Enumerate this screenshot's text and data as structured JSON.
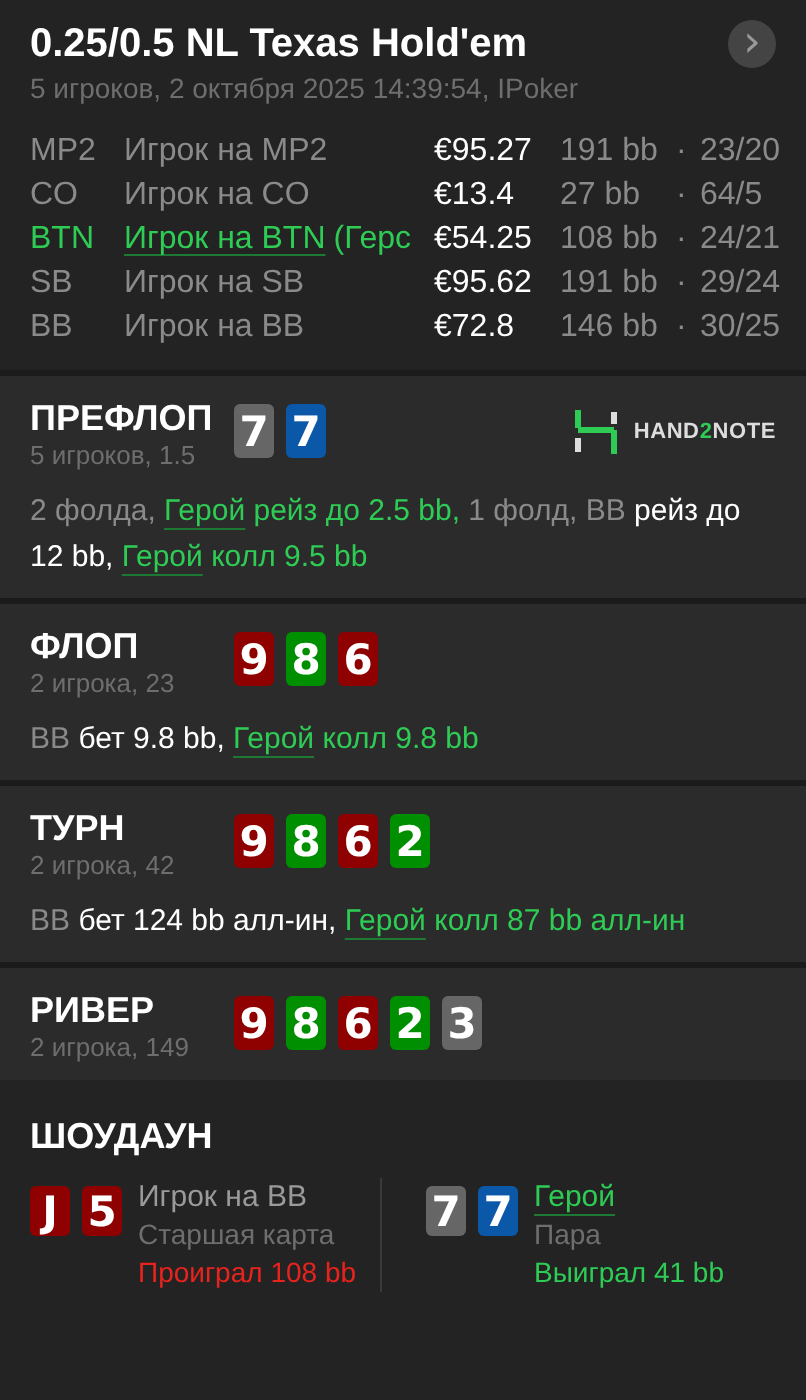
{
  "header": {
    "title": "0.25/0.5 NL Texas Hold'em",
    "subtitle": "5 игроков, 2 октября 2025 14:39:54, IPoker",
    "next_button": "›"
  },
  "players": [
    {
      "position": "MP2",
      "name": "Игрок на MP2",
      "hero": false,
      "stack": "€95.27",
      "bb": "191 bb",
      "separator": "·",
      "stats": "23/20"
    },
    {
      "position": "CO",
      "name": "Игрок на CO",
      "hero": false,
      "stack": "€13.4",
      "bb": "27 bb",
      "separator": "·",
      "stats": "64/5"
    },
    {
      "position": "BTN",
      "name": "Игрок на BTN",
      "note": "(Герс",
      "hero": true,
      "stack": "€54.25",
      "bb": "108 bb",
      "separator": "·",
      "stats": "24/21"
    },
    {
      "position": "SB",
      "name": "Игрок на SB",
      "hero": false,
      "stack": "€95.62",
      "bb": "191 bb",
      "separator": "·",
      "stats": "29/24"
    },
    {
      "position": "BB",
      "name": "Игрок на BB",
      "hero": false,
      "stack": "€72.8",
      "bb": "146 bb",
      "separator": "·",
      "stats": "30/25"
    }
  ],
  "streets": [
    {
      "title": "ПРЕФЛОП",
      "subtitle": "5 игроков, 1.5",
      "logo": {
        "before": "HAND",
        "accent": "2",
        "after": "NOTE"
      },
      "cards": [
        {
          "rank": "7",
          "color": "#666666"
        },
        {
          "rank": "7",
          "color": "#0b57a8"
        }
      ],
      "actions": [
        {
          "kind": "muted",
          "text": "2 фолда, "
        },
        {
          "kind": "hero-link",
          "text": "Герой"
        },
        {
          "kind": "hero",
          "text": " рейз до 2.5 bb, "
        },
        {
          "kind": "muted",
          "text": "1 фолд, BB "
        },
        {
          "kind": "bold",
          "text": "рейз до 12 bb, "
        },
        {
          "kind": "hero-link",
          "text": "Герой"
        },
        {
          "kind": "hero",
          "text": " колл 9.5 bb"
        }
      ]
    },
    {
      "title": "ФЛОП",
      "subtitle": "2 игрока, 23",
      "cards": [
        {
          "rank": "9",
          "color": "#8f0000"
        },
        {
          "rank": "8",
          "color": "#008f00"
        },
        {
          "rank": "6",
          "color": "#8f0000"
        }
      ],
      "actions": [
        {
          "kind": "muted",
          "text": "BB "
        },
        {
          "kind": "bold",
          "text": "бет 9.8 bb, "
        },
        {
          "kind": "hero-link",
          "text": "Герой"
        },
        {
          "kind": "hero",
          "text": " колл 9.8 bb"
        }
      ]
    },
    {
      "title": "ТУРН",
      "subtitle": "2 игрока, 42",
      "cards": [
        {
          "rank": "9",
          "color": "#8f0000"
        },
        {
          "rank": "8",
          "color": "#008f00"
        },
        {
          "rank": "6",
          "color": "#8f0000"
        },
        {
          "rank": "2",
          "color": "#008f00"
        }
      ],
      "actions": [
        {
          "kind": "muted",
          "text": "BB "
        },
        {
          "kind": "bold",
          "text": "бет 124 bb алл-ин, "
        },
        {
          "kind": "hero-link",
          "text": "Герой"
        },
        {
          "kind": "hero",
          "text": " колл 87 bb алл-ин"
        }
      ]
    },
    {
      "title": "РИВЕР",
      "subtitle": "2 игрока, 149",
      "cards": [
        {
          "rank": "9",
          "color": "#8f0000"
        },
        {
          "rank": "8",
          "color": "#008f00"
        },
        {
          "rank": "6",
          "color": "#8f0000"
        },
        {
          "rank": "2",
          "color": "#008f00"
        },
        {
          "rank": "3",
          "color": "#666666"
        }
      ]
    }
  ],
  "showdown": {
    "title": "ШОУДАУН",
    "hands": [
      {
        "cards": [
          {
            "rank": "J",
            "color": "#8f0000"
          },
          {
            "rank": "5",
            "color": "#8f0000"
          }
        ],
        "name": "Игрок на BB",
        "hero": false,
        "hand": "Старшая карта",
        "result": "Проиграл 108 bb",
        "won": false
      },
      {
        "cards": [
          {
            "rank": "7",
            "color": "#666666"
          },
          {
            "rank": "7",
            "color": "#0b57a8"
          }
        ],
        "name": "Герой",
        "hero": true,
        "hand": "Пара",
        "result": "Выиграл 41 bb",
        "won": true
      }
    ]
  }
}
